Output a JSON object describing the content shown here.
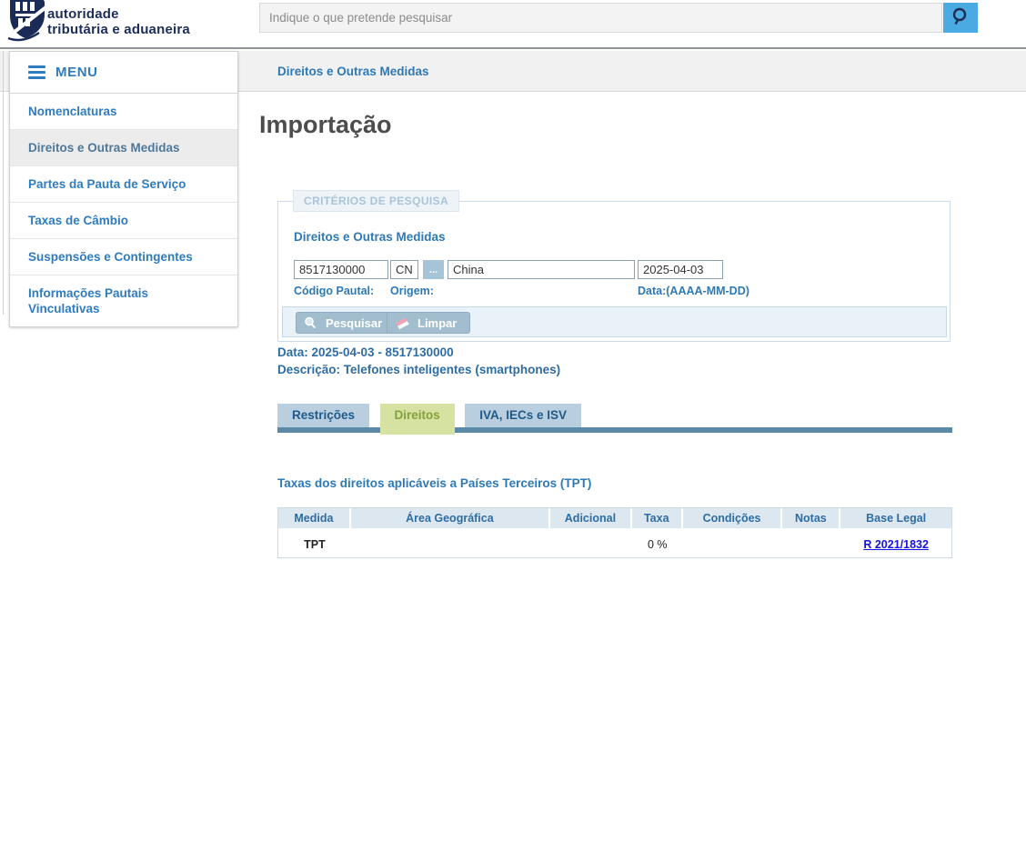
{
  "header": {
    "logo_line1": "autoridade",
    "logo_line2": "tributária e aduaneira",
    "search_placeholder": "Indique o que pretende pesquisar"
  },
  "icons": {
    "header_search": "magnifier-icon",
    "menu": "hamburger-icon",
    "pesquisar": "magnifier-icon",
    "limpar": "eraser-icon"
  },
  "sidebar": {
    "menu_label": "MENU",
    "items": [
      {
        "label": "Nomenclaturas",
        "selected": false
      },
      {
        "label": "Direitos e Outras Medidas",
        "selected": true
      },
      {
        "label": "Partes da Pauta de Serviço",
        "selected": false
      },
      {
        "label": "Taxas de Câmbio",
        "selected": false
      },
      {
        "label": "Suspensões e Contingentes",
        "selected": false
      },
      {
        "label": "Informações Pautais Vinculativas",
        "selected": false
      }
    ]
  },
  "breadcrumb": "Direitos e Outras Medidas",
  "page_title": "Importação",
  "search_form": {
    "legend": "CRITÉRIOS DE PESQUISA",
    "section_label": "Direitos e Outras Medidas",
    "fields": {
      "codigo_pautal": {
        "value": "8517130000",
        "label": "Código Pautal:"
      },
      "origem": {
        "value": "CN",
        "label": "Origem:"
      },
      "origem_lookup": "...",
      "origem_nome": {
        "value": "China"
      },
      "data": {
        "value": "2025-04-03",
        "label": "Data:(AAAA-MM-DD)"
      }
    },
    "buttons": {
      "pesquisar": "Pesquisar",
      "limpar": "Limpar"
    }
  },
  "result": {
    "data_line": "Data: 2025-04-03 - 8517130000",
    "descricao_line": "Descrição: Telefones inteligentes (smartphones)"
  },
  "tabs": [
    {
      "label": "Restrições",
      "active": false
    },
    {
      "label": "Direitos",
      "active": true
    },
    {
      "label": "IVA, IECs e ISV",
      "active": false
    }
  ],
  "tpt_section": {
    "heading": "Taxas dos direitos aplicáveis a Países Terceiros (TPT)",
    "table": {
      "columns": [
        "Medida",
        "Área Geográfica",
        "Adicional",
        "Taxa",
        "Condições",
        "Notas",
        "Base Legal"
      ],
      "rows": [
        {
          "medida": "TPT",
          "area_geografica": "",
          "adicional": "",
          "taxa": "0 %",
          "condicoes": "",
          "notas": "",
          "base_legal": "R 2021/1832"
        }
      ]
    }
  },
  "colors": {
    "brand_navy": "#1c2d5a",
    "link_blue": "#2e7cbf",
    "breadcrumb_blue": "#2e79b5",
    "search_button_blue": "#4aabe3",
    "tab_inactive_bg": "#b9cfdf",
    "tab_active_bg": "#d5e2a2",
    "tab_active_text": "#87a03b",
    "tab_bar": "#5d89a8",
    "table_header_bg": "#dce7f0",
    "form_button_bg": "#a2bdce",
    "base_legal_link": "#1414e0"
  }
}
